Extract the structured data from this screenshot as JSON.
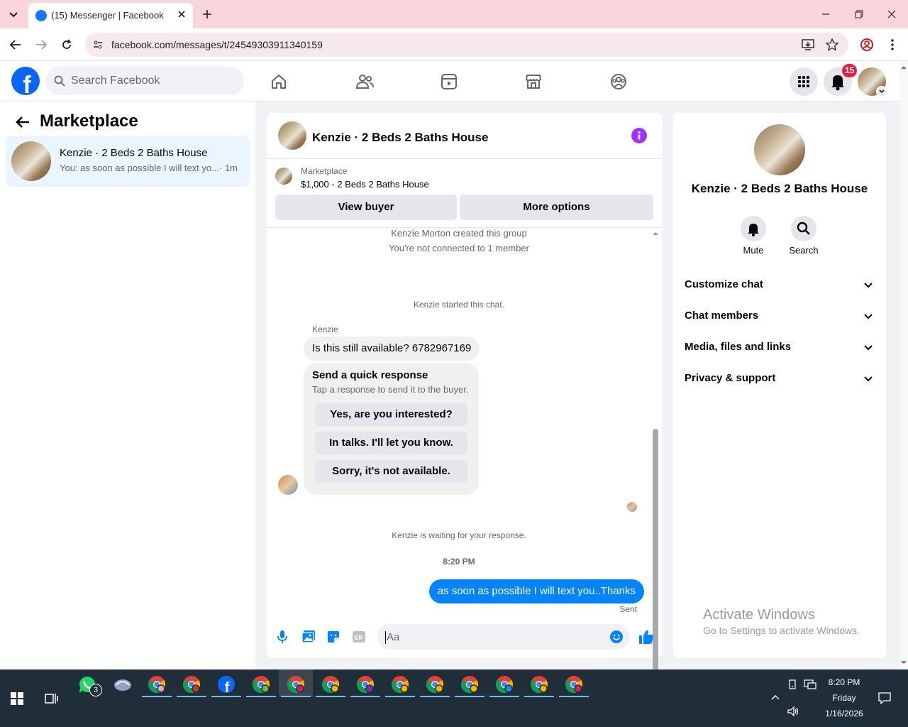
{
  "browser": {
    "tab_title": "(15) Messenger | Facebook",
    "url": "facebook.com/messages/t/24549303911340159"
  },
  "fb_header": {
    "search_placeholder": "Search Facebook",
    "notifications_count": "15"
  },
  "left_panel": {
    "title": "Marketplace",
    "chat_item": {
      "name": "Kenzie · 2 Beds 2 Baths House",
      "preview": "You: as soon as possible I will text yo...",
      "time": "· 1m"
    }
  },
  "chat": {
    "header_title": "Kenzie · 2 Beds 2 Baths House",
    "listing_label": "Marketplace",
    "listing_title": "$1,000 - 2 Beds 2 Baths House",
    "view_buyer": "View buyer",
    "more_options": "More options",
    "system_1": "Kenzie Morton created this group",
    "system_2": "You're not connected to 1 member",
    "system_3": "Kenzie started this chat.",
    "sender_name": "Kenzie",
    "incoming_message": "Is this still available? 6782967169",
    "quick_title": "Send a quick response",
    "quick_subtitle": "Tap a response to send it to the buyer.",
    "quick_responses": [
      "Yes, are you interested?",
      "In talks. I'll let you know.",
      "Sorry, it's not available."
    ],
    "waiting": "Kenzie is waiting for your response.",
    "timestamp": "8:20 PM",
    "outgoing_message": "as soon as possible I will text you..Thanks",
    "sent_status": "Sent",
    "composer_placeholder": "Aa"
  },
  "info_panel": {
    "title": "Kenzie · 2 Beds 2 Baths House",
    "mute_label": "Mute",
    "search_label": "Search",
    "sections": [
      "Customize chat",
      "Chat members",
      "Media, files and links",
      "Privacy & support"
    ]
  },
  "watermark": {
    "line1": "Activate Windows",
    "line2": "Go to Settings to activate Windows."
  },
  "taskbar": {
    "whatsapp_count": "3",
    "time": "8:20 PM",
    "day": "Friday",
    "date": "1/16/2026"
  },
  "colors": {
    "brand_blue": "#0866ff",
    "messenger_blue": "#0084ff",
    "info_purple": "#a033ff",
    "tab_strip_pink": "#f9d6dc"
  }
}
